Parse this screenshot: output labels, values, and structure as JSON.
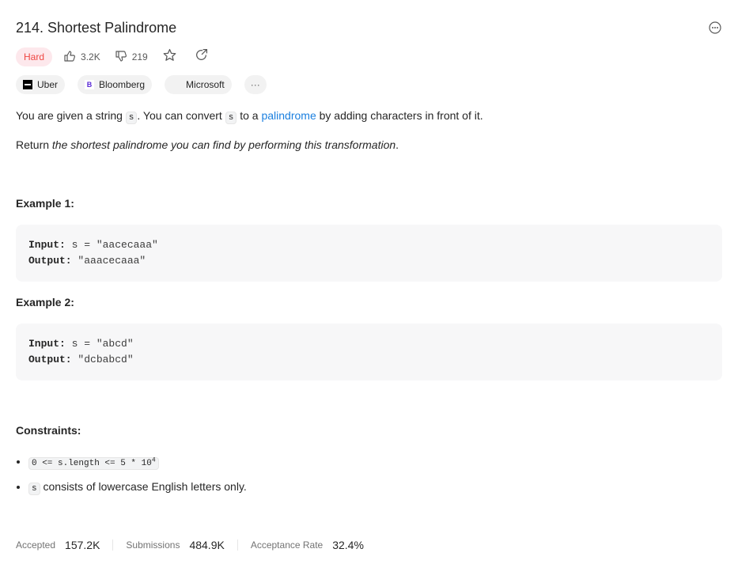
{
  "problem": {
    "title": "214. Shortest Palindrome",
    "difficulty": "Hard",
    "likes": "3.2K",
    "dislikes": "219"
  },
  "companies": [
    {
      "name": "Uber"
    },
    {
      "name": "Bloomberg"
    },
    {
      "name": "Microsoft"
    }
  ],
  "more_label": "···",
  "description": {
    "p1_a": "You are given a string ",
    "var_s": "s",
    "p1_b": ". You can convert ",
    "p1_c": " to a ",
    "link_text": "palindrome",
    "p1_d": " by adding characters in front of it.",
    "p2_a": "Return ",
    "p2_em": "the shortest palindrome you can find by performing this transformation",
    "p2_b": "."
  },
  "examples": [
    {
      "heading": "Example 1:",
      "input_label": "Input:",
      "input_value": " s = \"aacecaaa\"",
      "output_label": "Output:",
      "output_value": " \"aaacecaaa\""
    },
    {
      "heading": "Example 2:",
      "input_label": "Input:",
      "input_value": " s = \"abcd\"",
      "output_label": "Output:",
      "output_value": " \"dcbabcd\""
    }
  ],
  "constraints": {
    "heading": "Constraints:",
    "c1_code": "0 <= s.length <= 5 * 10",
    "c1_sup": "4",
    "c2_code": "s",
    "c2_text": " consists of lowercase English letters only."
  },
  "stats": {
    "accepted_label": "Accepted",
    "accepted_value": "157.2K",
    "submissions_label": "Submissions",
    "submissions_value": "484.9K",
    "rate_label": "Acceptance Rate",
    "rate_value": "32.4%"
  },
  "colors": {
    "hard": "#ef4743",
    "link": "#1a7fdf"
  }
}
